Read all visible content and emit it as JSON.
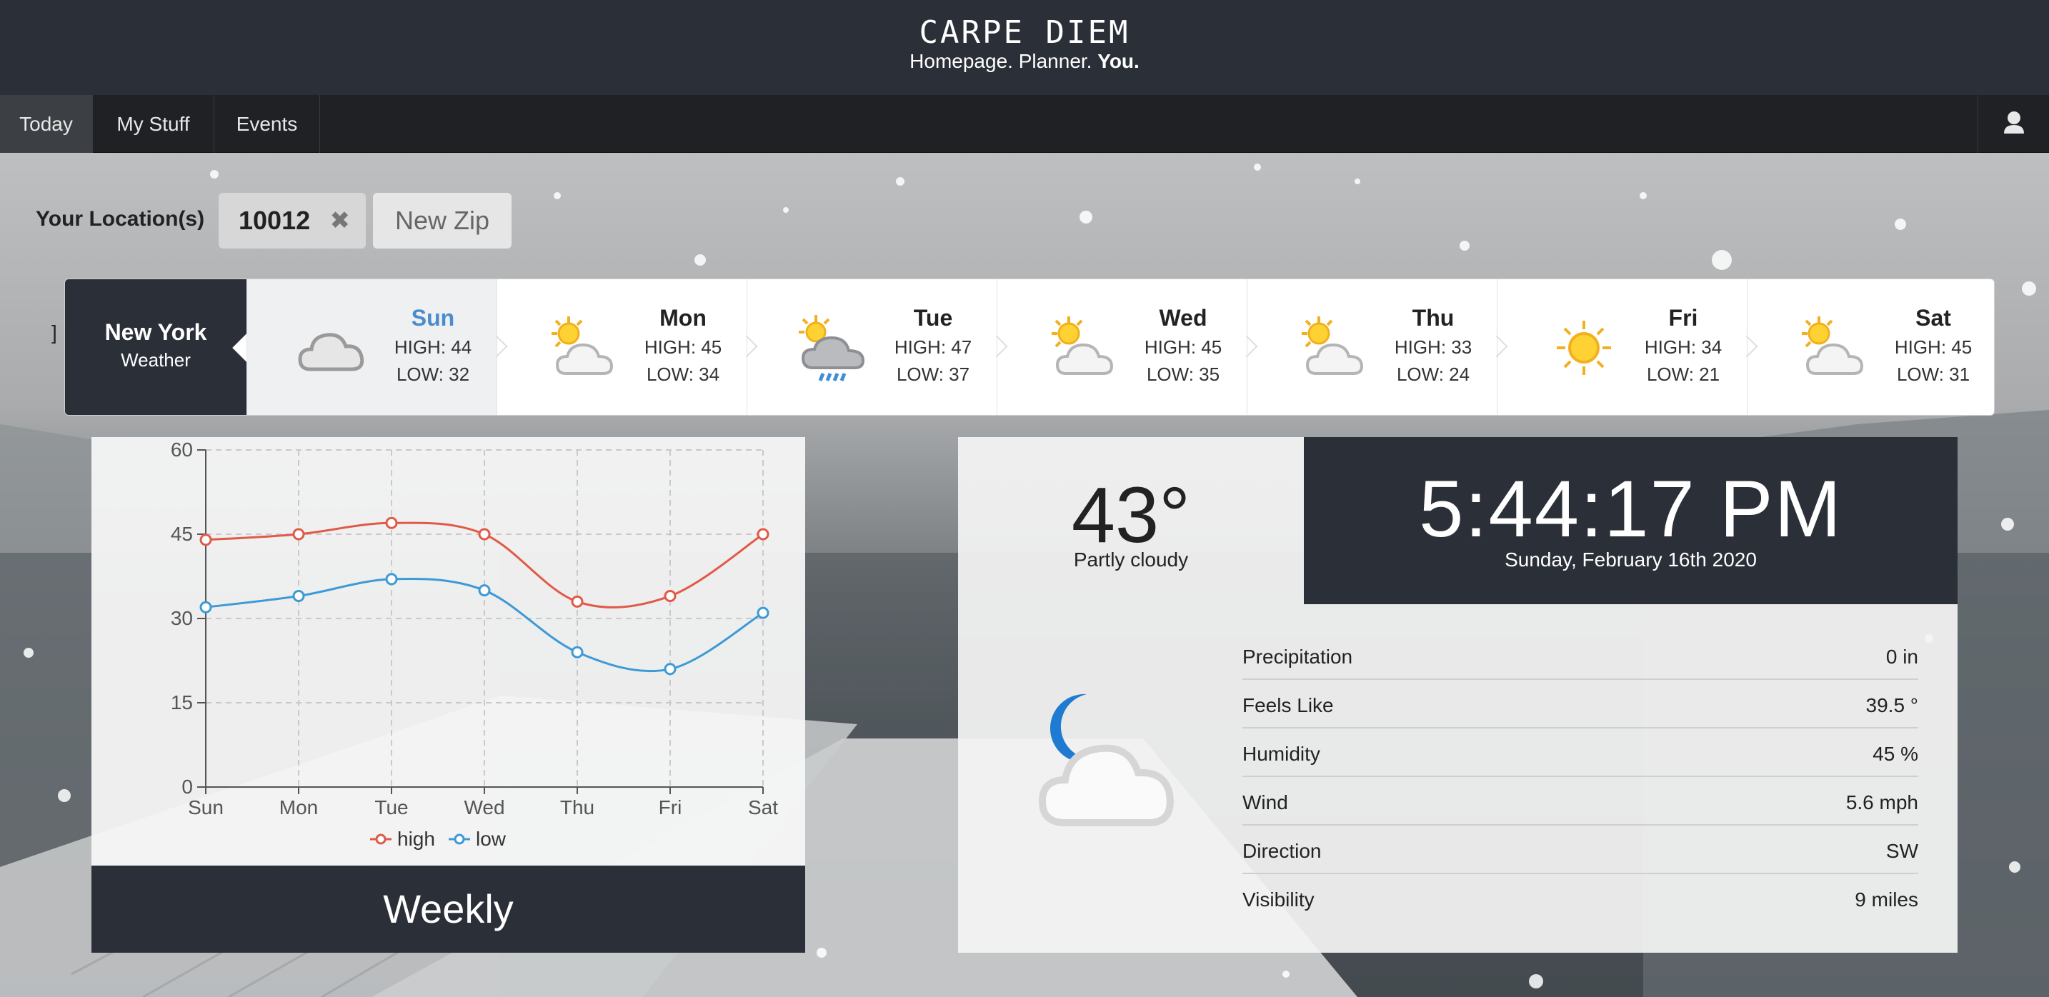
{
  "header": {
    "brand": "CARPE DIEM",
    "tagline_prefix": "Homepage. Planner.",
    "tagline_bold": "You."
  },
  "nav": {
    "items": [
      "Today",
      "My Stuff",
      "Events"
    ],
    "active": "Today",
    "user_icon": "user-icon"
  },
  "locations": {
    "label": "Your Location(s)",
    "zip": "10012",
    "remove_glyph": "✖",
    "new_zip_label": "New Zip",
    "stray_text": "]"
  },
  "forecast": {
    "city": "New York",
    "subtitle": "Weather",
    "days": [
      {
        "name": "Sun",
        "high": "HIGH: 44",
        "low": "LOW: 32",
        "icon": "cloudy-icon"
      },
      {
        "name": "Mon",
        "high": "HIGH: 45",
        "low": "LOW: 34",
        "icon": "partly-cloudy-icon"
      },
      {
        "name": "Tue",
        "high": "HIGH: 47",
        "low": "LOW: 37",
        "icon": "rain-icon"
      },
      {
        "name": "Wed",
        "high": "HIGH: 45",
        "low": "LOW: 35",
        "icon": "partly-cloudy-icon"
      },
      {
        "name": "Thu",
        "high": "HIGH: 33",
        "low": "LOW: 24",
        "icon": "partly-cloudy-icon"
      },
      {
        "name": "Fri",
        "high": "HIGH: 34",
        "low": "LOW: 21",
        "icon": "sunny-icon"
      },
      {
        "name": "Sat",
        "high": "HIGH: 45",
        "low": "LOW: 31",
        "icon": "partly-cloudy-icon"
      }
    ]
  },
  "chart_data": {
    "type": "line",
    "categories": [
      "Sun",
      "Mon",
      "Tue",
      "Wed",
      "Thu",
      "Fri",
      "Sat"
    ],
    "series": [
      {
        "name": "high",
        "values": [
          44,
          45,
          47,
          45,
          33,
          34,
          45
        ],
        "color": "#e05a47"
      },
      {
        "name": "low",
        "values": [
          32,
          34,
          37,
          35,
          24,
          21,
          31
        ],
        "color": "#3d9ad6"
      }
    ],
    "ylim": [
      0,
      60
    ],
    "yticks": [
      "0",
      "15",
      "30",
      "45",
      "60"
    ],
    "grid": true,
    "legend": "bottom"
  },
  "weekly_label": "Weekly",
  "current": {
    "temperature": "43°",
    "condition": "Partly cloudy",
    "time": "5:44:17 PM",
    "date": "Sunday, February 16th 2020",
    "icon": "night-cloudy-icon",
    "stats": [
      {
        "label": "Precipitation",
        "value": "0 in"
      },
      {
        "label": "Feels Like",
        "value": "39.5 °"
      },
      {
        "label": "Humidity",
        "value": "45 %"
      },
      {
        "label": "Wind",
        "value": "5.6 mph"
      },
      {
        "label": "Direction",
        "value": "SW"
      },
      {
        "label": "Visibility",
        "value": "9 miles"
      }
    ]
  },
  "colors": {
    "header_bg": "#2b2f38",
    "nav_bg": "#1f2124",
    "active_day": "#4a8ccc"
  }
}
